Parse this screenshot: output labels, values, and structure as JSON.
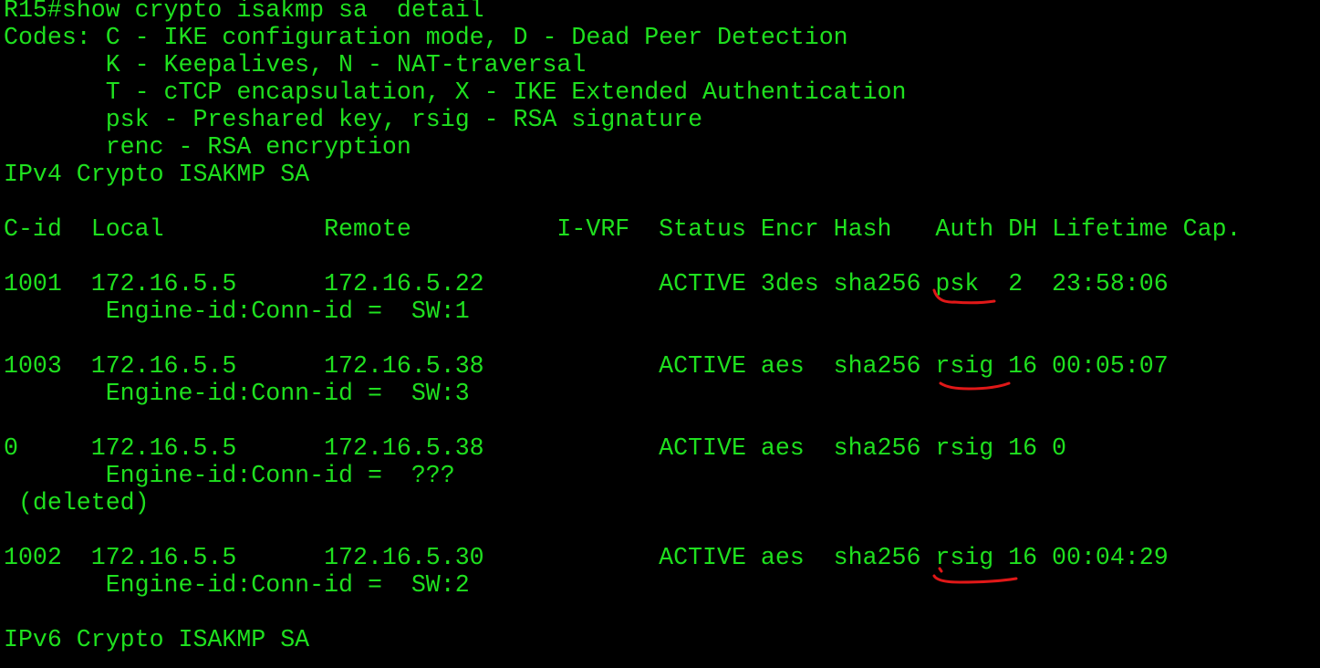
{
  "terminal": {
    "text_color": "#1fe01f",
    "background_color": "#000000",
    "annotation_color": "#e01818",
    "lines": [
      "R15#show crypto isakmp sa  detail",
      "Codes: C - IKE configuration mode, D - Dead Peer Detection",
      "       K - Keepalives, N - NAT-traversal",
      "       T - cTCP encapsulation, X - IKE Extended Authentication",
      "       psk - Preshared key, rsig - RSA signature",
      "       renc - RSA encryption",
      "IPv4 Crypto ISAKMP SA",
      "",
      "C-id  Local           Remote          I-VRF  Status Encr Hash   Auth DH Lifetime Cap.",
      "",
      "1001  172.16.5.5      172.16.5.22            ACTIVE 3des sha256 psk  2  23:58:06",
      "       Engine-id:Conn-id =  SW:1",
      "",
      "1003  172.16.5.5      172.16.5.38            ACTIVE aes  sha256 rsig 16 00:05:07",
      "       Engine-id:Conn-id =  SW:3",
      "",
      "0     172.16.5.5      172.16.5.38            ACTIVE aes  sha256 rsig 16 0",
      "       Engine-id:Conn-id =  ???",
      " (deleted)",
      "",
      "1002  172.16.5.5      172.16.5.30            ACTIVE aes  sha256 rsig 16 00:04:29",
      "       Engine-id:Conn-id =  SW:2",
      "",
      "IPv6 Crypto ISAKMP SA"
    ]
  }
}
